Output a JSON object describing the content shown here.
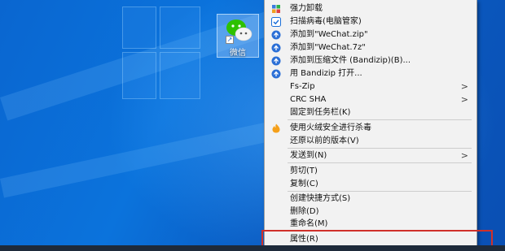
{
  "desktop": {
    "icon": {
      "label": "微信",
      "icon_name": "wechat-icon"
    }
  },
  "context_menu": {
    "items": [
      {
        "label": "强力卸载",
        "icon": "uninstall-icon"
      },
      {
        "label": "扫描病毒(电脑管家)",
        "icon": "shield-scan-icon"
      },
      {
        "label": "添加到\"WeChat.zip\"",
        "icon": "bandizip-icon"
      },
      {
        "label": "添加到\"WeChat.7z\"",
        "icon": "bandizip-icon"
      },
      {
        "label": "添加到压缩文件 (Bandizip)(B)...",
        "icon": "bandizip-icon"
      },
      {
        "label": "用 Bandizip 打开...",
        "icon": "bandizip-icon"
      },
      {
        "label": "Fs-Zip",
        "submenu": true
      },
      {
        "label": "CRC SHA",
        "submenu": true
      },
      {
        "label": "固定到任务栏(K)"
      },
      {
        "label": "使用火绒安全进行杀毒",
        "icon": "huorong-icon"
      },
      {
        "label": "还原以前的版本(V)"
      },
      {
        "label": "发送到(N)",
        "submenu": true
      },
      {
        "label": "剪切(T)"
      },
      {
        "label": "复制(C)"
      },
      {
        "label": "创建快捷方式(S)"
      },
      {
        "label": "删除(D)"
      },
      {
        "label": "重命名(M)"
      },
      {
        "label": "属性(R)"
      }
    ],
    "submenu_arrow": ">"
  },
  "colors": {
    "desktop_blue": "#0a66d0",
    "menu_bg": "#f2f2f2",
    "highlight_box": "#d0302a"
  }
}
